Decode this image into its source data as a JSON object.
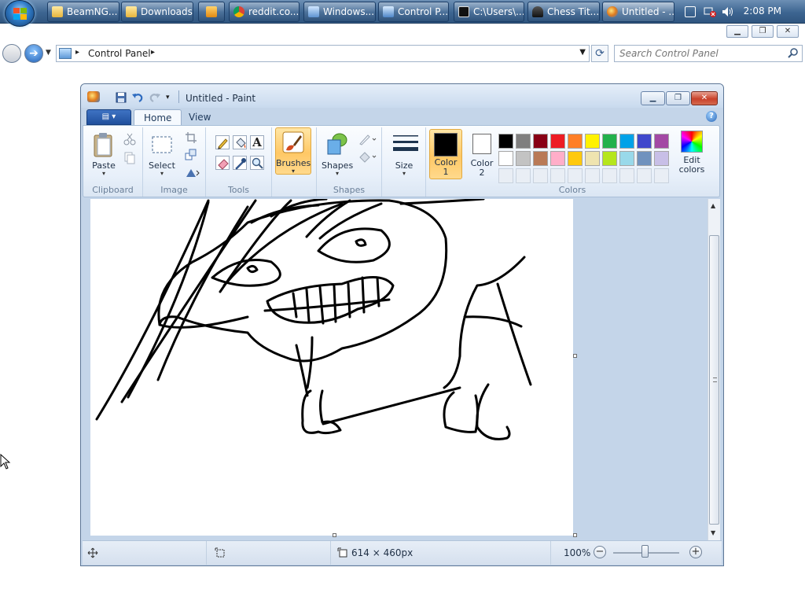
{
  "taskbar": {
    "buttons": [
      {
        "label": "BeamNG...",
        "active": false
      },
      {
        "label": "Downloads",
        "active": false
      },
      {
        "label": "",
        "active": false
      },
      {
        "label": "reddit.co...",
        "active": false
      },
      {
        "label": "Windows...",
        "active": false
      },
      {
        "label": "Control P...",
        "active": false
      },
      {
        "label": "C:\\Users\\...",
        "active": false
      },
      {
        "label": "Chess Tit...",
        "active": false
      },
      {
        "label": "Untitled - ...",
        "active": true
      }
    ],
    "clock": "2:08 PM"
  },
  "explorer": {
    "address": "Control Panel",
    "search_placeholder": "Search Control Panel"
  },
  "paint": {
    "title": "Untitled - Paint",
    "menu_glyph": "▤ ▾",
    "tabs": [
      "Home",
      "View"
    ],
    "help": "?",
    "groups": {
      "clipboard": {
        "label": "Clipboard",
        "paste": "Paste"
      },
      "image": {
        "label": "Image",
        "select": "Select"
      },
      "tools": {
        "label": "Tools"
      },
      "brushes": {
        "label": "Brushes"
      },
      "shapes": {
        "label": "Shapes",
        "button": "Shapes"
      },
      "size": {
        "label": "Size"
      },
      "colors": {
        "label": "Colors",
        "color1_line1": "Color",
        "color1_line2": "1",
        "color2_line1": "Color",
        "color2_line2": "2",
        "edit_line1": "Edit",
        "edit_line2": "colors",
        "color1_value": "#000000",
        "color2_value": "#ffffff",
        "palette_row1": [
          "#000000",
          "#7f7f7f",
          "#880015",
          "#ed1c24",
          "#ff7f27",
          "#fff200",
          "#22b14c",
          "#00a2e8",
          "#3f48cc",
          "#a349a4"
        ],
        "palette_row2": [
          "#ffffff",
          "#c3c3c3",
          "#b97a57",
          "#ffaec9",
          "#ffc90e",
          "#efe4b0",
          "#b5e61d",
          "#99d9ea",
          "#7092be",
          "#c8bfe7"
        ]
      }
    },
    "status": {
      "canvas_size": "614 × 460px",
      "zoom": "100%"
    },
    "text_tool_glyph": "A"
  }
}
